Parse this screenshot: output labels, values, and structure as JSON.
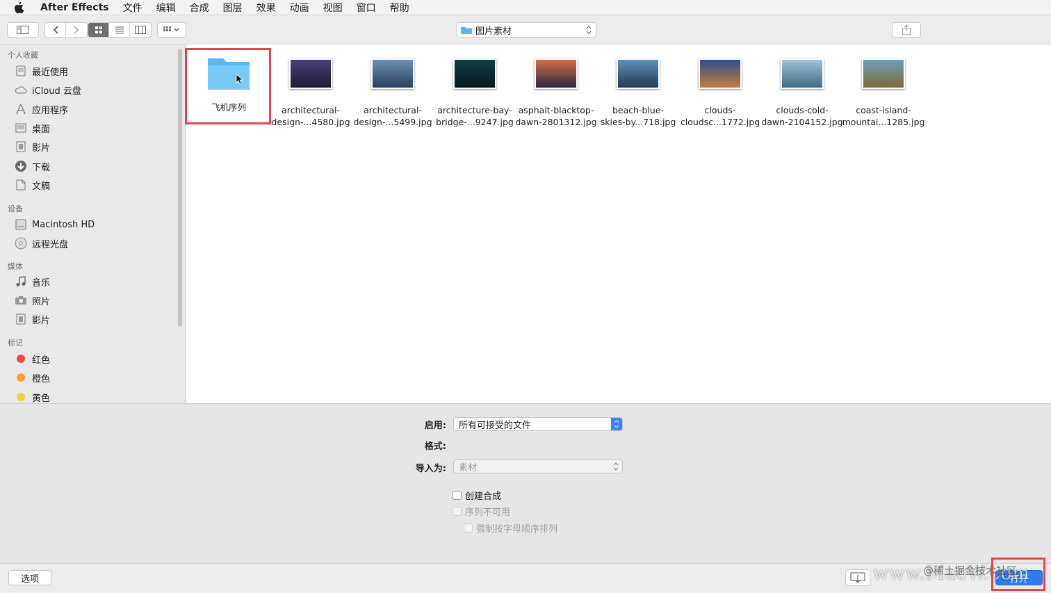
{
  "menubar": {
    "app_name": "After Effects",
    "items": [
      "文件",
      "编辑",
      "合成",
      "图层",
      "效果",
      "动画",
      "视图",
      "窗口",
      "帮助"
    ]
  },
  "toolbar": {
    "location": "图片素材",
    "icons": [
      "sidebar-toggle-icon",
      "back-icon",
      "forward-icon",
      "icon-view-icon",
      "list-view-icon",
      "column-view-icon",
      "arrange-icon",
      "share-icon"
    ]
  },
  "sidebar": {
    "favorites_header": "个人收藏",
    "favorites": [
      {
        "label": "最近使用",
        "icon": "recents-icon"
      },
      {
        "label": "iCloud 云盘",
        "icon": "cloud-icon"
      },
      {
        "label": "应用程序",
        "icon": "applications-icon"
      },
      {
        "label": "桌面",
        "icon": "desktop-icon"
      },
      {
        "label": "影片",
        "icon": "movies-icon"
      },
      {
        "label": "下载",
        "icon": "downloads-icon"
      },
      {
        "label": "文稿",
        "icon": "documents-icon"
      }
    ],
    "devices_header": "设备",
    "devices": [
      {
        "label": "Macintosh HD",
        "icon": "disk-icon"
      },
      {
        "label": "远程光盘",
        "icon": "remote-disc-icon"
      }
    ],
    "media_header": "媒体",
    "media": [
      {
        "label": "音乐",
        "icon": "music-icon"
      },
      {
        "label": "照片",
        "icon": "photos-icon"
      },
      {
        "label": "影片",
        "icon": "movies-icon"
      }
    ],
    "tags_header": "标记",
    "tags": [
      {
        "label": "红色",
        "color": "#ee4c4c"
      },
      {
        "label": "橙色",
        "color": "#f5a030"
      },
      {
        "label": "黄色",
        "color": "#f5d33a"
      }
    ]
  },
  "files": [
    {
      "name1": "飞机序列",
      "name2": "",
      "kind": "folder"
    },
    {
      "name1": "architectural-",
      "name2": "design-...4580.jpg",
      "kind": "image",
      "c1": "#4a3f7a",
      "c2": "#1d1b33"
    },
    {
      "name1": "architectural-",
      "name2": "design-...5499.jpg",
      "kind": "image",
      "c1": "#6a8fb5",
      "c2": "#27415f"
    },
    {
      "name1": "architecture-bay-",
      "name2": "bridge-...9247.jpg",
      "kind": "image",
      "c1": "#0e3f3f",
      "c2": "#041a1d"
    },
    {
      "name1": "asphalt-blacktop-",
      "name2": "dawn-2801312.jpg",
      "kind": "image",
      "c1": "#d07045",
      "c2": "#2a2540"
    },
    {
      "name1": "beach-blue-",
      "name2": "skies-by...718.jpg",
      "kind": "image",
      "c1": "#5d8fb8",
      "c2": "#233c55"
    },
    {
      "name1": "clouds-",
      "name2": "cloudsc...1772.jpg",
      "kind": "image",
      "c1": "#2b4f87",
      "c2": "#c77c3d"
    },
    {
      "name1": "clouds-cold-",
      "name2": "dawn-2104152.jpg",
      "kind": "image",
      "c1": "#9fc3d8",
      "c2": "#3e6c86"
    },
    {
      "name1": "coast-island-",
      "name2": "mountai...1285.jpg",
      "kind": "image",
      "c1": "#6aa0b8",
      "c2": "#7f6b3a"
    }
  ],
  "options": {
    "enable_label": "启用:",
    "enable_value": "所有可接受的文件",
    "format_label": "格式:",
    "import_as_label": "导入为:",
    "import_as_value": "素材",
    "create_comp": "创建合成",
    "sequence_unavailable": "序列不可用",
    "force_alpha": "强制按字母顺序排列"
  },
  "bottom": {
    "options_button": "选项",
    "open_button": "打开",
    "watermark_text": "www.MacW.com",
    "watermark_credit": "@稀土掘金技术社区"
  }
}
